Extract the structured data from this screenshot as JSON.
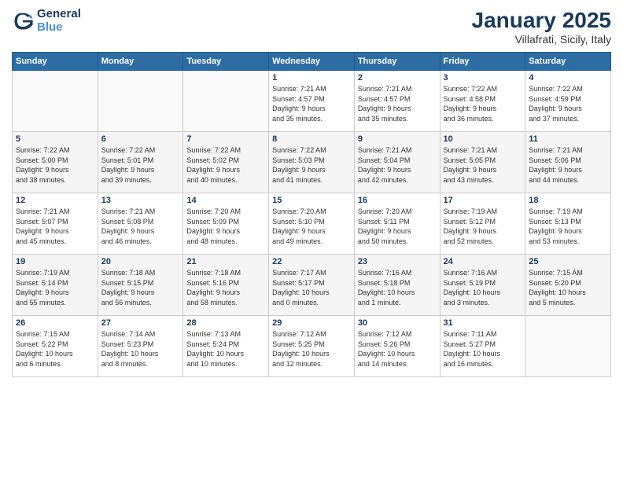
{
  "logo": {
    "line1": "General",
    "line2": "Blue"
  },
  "header": {
    "title": "January 2025",
    "location": "Villafrati, Sicily, Italy"
  },
  "weekdays": [
    "Sunday",
    "Monday",
    "Tuesday",
    "Wednesday",
    "Thursday",
    "Friday",
    "Saturday"
  ],
  "weeks": [
    [
      {
        "day": "",
        "info": ""
      },
      {
        "day": "",
        "info": ""
      },
      {
        "day": "",
        "info": ""
      },
      {
        "day": "1",
        "info": "Sunrise: 7:21 AM\nSunset: 4:57 PM\nDaylight: 9 hours\nand 35 minutes."
      },
      {
        "day": "2",
        "info": "Sunrise: 7:21 AM\nSunset: 4:57 PM\nDaylight: 9 hours\nand 35 minutes."
      },
      {
        "day": "3",
        "info": "Sunrise: 7:22 AM\nSunset: 4:58 PM\nDaylight: 9 hours\nand 36 minutes."
      },
      {
        "day": "4",
        "info": "Sunrise: 7:22 AM\nSunset: 4:59 PM\nDaylight: 9 hours\nand 37 minutes."
      }
    ],
    [
      {
        "day": "5",
        "info": "Sunrise: 7:22 AM\nSunset: 5:00 PM\nDaylight: 9 hours\nand 38 minutes."
      },
      {
        "day": "6",
        "info": "Sunrise: 7:22 AM\nSunset: 5:01 PM\nDaylight: 9 hours\nand 39 minutes."
      },
      {
        "day": "7",
        "info": "Sunrise: 7:22 AM\nSunset: 5:02 PM\nDaylight: 9 hours\nand 40 minutes."
      },
      {
        "day": "8",
        "info": "Sunrise: 7:22 AM\nSunset: 5:03 PM\nDaylight: 9 hours\nand 41 minutes."
      },
      {
        "day": "9",
        "info": "Sunrise: 7:21 AM\nSunset: 5:04 PM\nDaylight: 9 hours\nand 42 minutes."
      },
      {
        "day": "10",
        "info": "Sunrise: 7:21 AM\nSunset: 5:05 PM\nDaylight: 9 hours\nand 43 minutes."
      },
      {
        "day": "11",
        "info": "Sunrise: 7:21 AM\nSunset: 5:06 PM\nDaylight: 9 hours\nand 44 minutes."
      }
    ],
    [
      {
        "day": "12",
        "info": "Sunrise: 7:21 AM\nSunset: 5:07 PM\nDaylight: 9 hours\nand 45 minutes."
      },
      {
        "day": "13",
        "info": "Sunrise: 7:21 AM\nSunset: 5:08 PM\nDaylight: 9 hours\nand 46 minutes."
      },
      {
        "day": "14",
        "info": "Sunrise: 7:20 AM\nSunset: 5:09 PM\nDaylight: 9 hours\nand 48 minutes."
      },
      {
        "day": "15",
        "info": "Sunrise: 7:20 AM\nSunset: 5:10 PM\nDaylight: 9 hours\nand 49 minutes."
      },
      {
        "day": "16",
        "info": "Sunrise: 7:20 AM\nSunset: 5:11 PM\nDaylight: 9 hours\nand 50 minutes."
      },
      {
        "day": "17",
        "info": "Sunrise: 7:19 AM\nSunset: 5:12 PM\nDaylight: 9 hours\nand 52 minutes."
      },
      {
        "day": "18",
        "info": "Sunrise: 7:19 AM\nSunset: 5:13 PM\nDaylight: 9 hours\nand 53 minutes."
      }
    ],
    [
      {
        "day": "19",
        "info": "Sunrise: 7:19 AM\nSunset: 5:14 PM\nDaylight: 9 hours\nand 55 minutes."
      },
      {
        "day": "20",
        "info": "Sunrise: 7:18 AM\nSunset: 5:15 PM\nDaylight: 9 hours\nand 56 minutes."
      },
      {
        "day": "21",
        "info": "Sunrise: 7:18 AM\nSunset: 5:16 PM\nDaylight: 9 hours\nand 58 minutes."
      },
      {
        "day": "22",
        "info": "Sunrise: 7:17 AM\nSunset: 5:17 PM\nDaylight: 10 hours\nand 0 minutes."
      },
      {
        "day": "23",
        "info": "Sunrise: 7:16 AM\nSunset: 5:18 PM\nDaylight: 10 hours\nand 1 minute."
      },
      {
        "day": "24",
        "info": "Sunrise: 7:16 AM\nSunset: 5:19 PM\nDaylight: 10 hours\nand 3 minutes."
      },
      {
        "day": "25",
        "info": "Sunrise: 7:15 AM\nSunset: 5:20 PM\nDaylight: 10 hours\nand 5 minutes."
      }
    ],
    [
      {
        "day": "26",
        "info": "Sunrise: 7:15 AM\nSunset: 5:22 PM\nDaylight: 10 hours\nand 6 minutes."
      },
      {
        "day": "27",
        "info": "Sunrise: 7:14 AM\nSunset: 5:23 PM\nDaylight: 10 hours\nand 8 minutes."
      },
      {
        "day": "28",
        "info": "Sunrise: 7:13 AM\nSunset: 5:24 PM\nDaylight: 10 hours\nand 10 minutes."
      },
      {
        "day": "29",
        "info": "Sunrise: 7:12 AM\nSunset: 5:25 PM\nDaylight: 10 hours\nand 12 minutes."
      },
      {
        "day": "30",
        "info": "Sunrise: 7:12 AM\nSunset: 5:26 PM\nDaylight: 10 hours\nand 14 minutes."
      },
      {
        "day": "31",
        "info": "Sunrise: 7:11 AM\nSunset: 5:27 PM\nDaylight: 10 hours\nand 16 minutes."
      },
      {
        "day": "",
        "info": ""
      }
    ]
  ]
}
